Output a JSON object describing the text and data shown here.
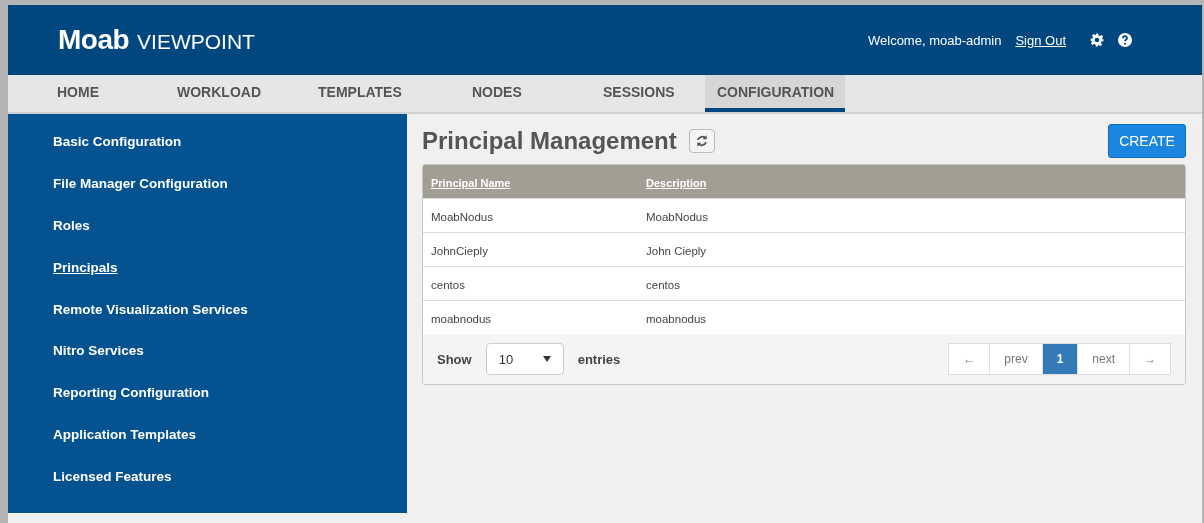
{
  "header": {
    "logo_bold": "Moab",
    "logo_light": "VIEWPOINT",
    "welcome": "Welcome, moab-admin",
    "sign_out": "Sign Out"
  },
  "tabs": [
    {
      "label": "HOME",
      "selected": false
    },
    {
      "label": "WORKLOAD",
      "selected": false
    },
    {
      "label": "TEMPLATES",
      "selected": false
    },
    {
      "label": "NODES",
      "selected": false
    },
    {
      "label": "SESSIONS",
      "selected": false
    },
    {
      "label": "CONFIGURATION",
      "selected": true
    }
  ],
  "sidebar": {
    "items": [
      {
        "label": "Basic Configuration",
        "selected": false
      },
      {
        "label": "File Manager Configuration",
        "selected": false
      },
      {
        "label": "Roles",
        "selected": false
      },
      {
        "label": "Principals",
        "selected": true
      },
      {
        "label": "Remote Visualization Services",
        "selected": false
      },
      {
        "label": "Nitro Services",
        "selected": false
      },
      {
        "label": "Reporting Configuration",
        "selected": false
      },
      {
        "label": "Application Templates",
        "selected": false
      },
      {
        "label": "Licensed Features",
        "selected": false
      }
    ]
  },
  "page": {
    "title": "Principal Management",
    "create_button": "CREATE"
  },
  "table": {
    "columns": [
      "Principal Name",
      "Description"
    ],
    "rows": [
      [
        "MoabNodus",
        "MoabNodus"
      ],
      [
        "JohnCieply",
        "John Cieply"
      ],
      [
        "centos",
        "centos"
      ],
      [
        "moabnodus",
        "moabnodus"
      ]
    ]
  },
  "footer": {
    "show_label": "Show",
    "page_size": "10",
    "entries_label": "entries",
    "pagination": [
      {
        "label": "←",
        "selected": false
      },
      {
        "label": "prev",
        "selected": false
      },
      {
        "label": "1",
        "selected": true
      },
      {
        "label": "next",
        "selected": false
      },
      {
        "label": "→",
        "selected": false
      }
    ]
  }
}
